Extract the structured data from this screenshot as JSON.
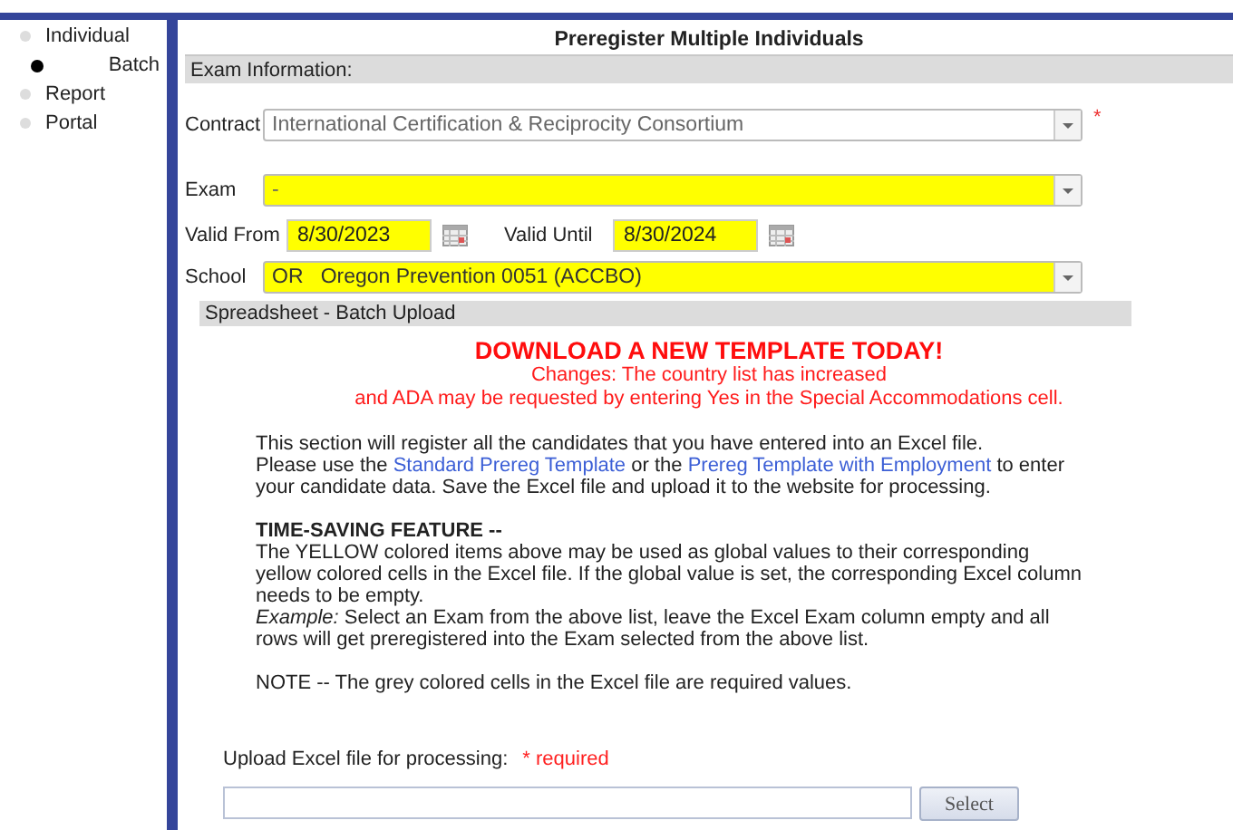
{
  "sidebar": {
    "items": [
      {
        "label": "Individual",
        "selected": false,
        "children": [
          {
            "label": "Batch",
            "selected": true
          }
        ]
      },
      {
        "label": "Report",
        "selected": false
      },
      {
        "label": "Portal",
        "selected": false
      }
    ]
  },
  "page_title": "Preregister Multiple Individuals",
  "exam_information": {
    "header": "Exam Information:",
    "contract": {
      "label": "Contract",
      "value": "International Certification & Reciprocity Consortium",
      "required_mark": "*"
    },
    "exam": {
      "label": "Exam",
      "value": "-"
    },
    "valid_from": {
      "label": "Valid From",
      "value": "8/30/2023"
    },
    "valid_until": {
      "label": "Valid Until",
      "value": "8/30/2024"
    },
    "school": {
      "label": "School",
      "value": "OR   Oregon Prevention 0051 (ACCBO)"
    }
  },
  "batch_upload": {
    "header": "Spreadsheet - Batch Upload",
    "headline": "DOWNLOAD A NEW TEMPLATE TODAY!",
    "changes": [
      "Changes: The country list has increased",
      "and ADA may be requested by entering Yes in the Special Accommodations cell."
    ],
    "intro": "This section will register all the candidates that you have entered into an Excel file.",
    "instructions": [
      {
        "kind": "text",
        "text": "Please use the"
      },
      {
        "kind": "link",
        "text": "Standard Prereg Template"
      },
      {
        "kind": "text",
        "text": "or the"
      },
      {
        "kind": "link",
        "text": "Prereg Template with Employment"
      },
      {
        "kind": "text",
        "text": "to enter your candidate data. Save the Excel file and upload it to the website for processing."
      }
    ],
    "feature_heading": "TIME-SAVING FEATURE --",
    "feature_text": "The YELLOW colored items above may be used as global values to their corresponding yellow colored cells in the Excel file.  If the global value is set, the corresponding Excel column needs to be empty.",
    "example": "*Example:* Select an Exam from the above list, leave the Excel Exam column empty and all rows will get preregistered into the Exam selected from the above list.",
    "note": "NOTE -- The grey colored cells in the Excel file are required values.",
    "upload_label": "Upload Excel file for processing:",
    "upload_required": "* required",
    "select_button": "Select"
  }
}
